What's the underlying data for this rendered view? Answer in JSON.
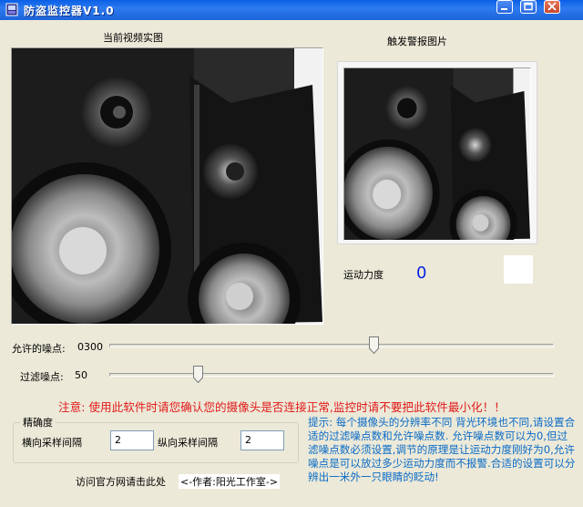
{
  "window": {
    "title": "防盗监控器V1.0"
  },
  "live_video": {
    "label": "当前视频实图"
  },
  "alarm_image": {
    "label": "触发警报图片"
  },
  "motion": {
    "label": "运动力度",
    "value": "0"
  },
  "noise_allowed": {
    "label": "允许的噪点:",
    "value": "0300",
    "slider_fraction": 0.5
  },
  "noise_filter": {
    "label": "过滤噪点:",
    "value": "50",
    "slider_fraction": 0.2
  },
  "warning": "注意: 使用此软件时请您确认您的摄像头是否连接正常,监控时请不要把此软件最小化！！",
  "precision": {
    "title": "精确度",
    "h_label": "横向采样间隔",
    "h_value": "2",
    "v_label": "纵向采样间隔",
    "v_value": "2"
  },
  "footer": {
    "link": "访问官方网请击此处",
    "author": "<-作者:阳光工作室->"
  },
  "hint": "提示: 每个摄像头的分辨率不同 背光环境也不同,请设置合适的过滤噪点数和允许噪点数. 允许噪点数可以为0,但过滤噪点数必须设置,调节的原理是让运动力度刚好为0,允许噪点是可以放过多少运动力度而不报警.合适的设置可以分辨出一米外一只眼睛的眨动!",
  "colors": {
    "title_bar": "#0A5FE6",
    "warning_text": "#E21A1A",
    "hint_text": "#0A6BC7",
    "motion_value": "#0A22E0"
  },
  "icons": [
    "app-icon",
    "minimize-icon",
    "maximize-icon",
    "close-icon"
  ]
}
